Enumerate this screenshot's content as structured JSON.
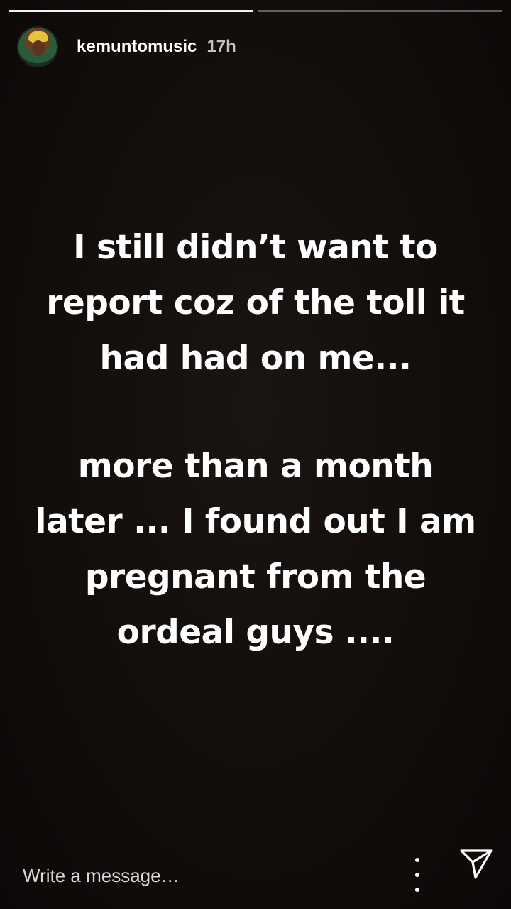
{
  "story": {
    "progress_segments": 2,
    "progress_current": 1
  },
  "header": {
    "username": "kemuntomusic",
    "time_ago": "17h",
    "avatar_icon": "avatar-icon"
  },
  "content": {
    "block1": [
      "I still didn’t want to",
      "report coz of the toll it",
      "had had on me..."
    ],
    "block2": [
      "more than a month",
      "later ... I found out I am",
      "pregnant from the",
      "ordeal guys ...."
    ]
  },
  "footer": {
    "message_placeholder": "Write a message…",
    "more_icon": "more-vertical-icon",
    "send_icon": "send-icon"
  },
  "colors": {
    "background": "#120e0c",
    "text": "#ffffff"
  }
}
